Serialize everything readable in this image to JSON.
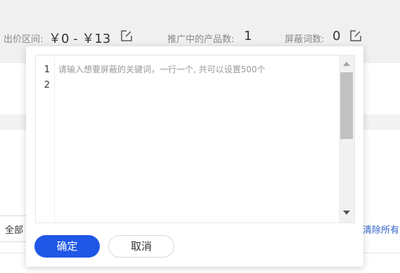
{
  "stats": {
    "price_range_label": "出价区间:",
    "price_range_value": "￥0 - ￥13",
    "products_label": "推广中的产品数:",
    "products_value": "1",
    "blocked_words_label": "屏蔽词数:",
    "blocked_words_value": "0"
  },
  "filter": {
    "selected": "全部"
  },
  "clear_all_label": "清除所有",
  "popover": {
    "line_numbers": [
      "1",
      "2"
    ],
    "placeholder": "请输入想要屏蔽的关键词，一行一个, 共可以设置500个",
    "confirm_label": "确定",
    "cancel_label": "取消"
  },
  "colors": {
    "primary": "#1f57e6",
    "link": "#3366cc"
  }
}
